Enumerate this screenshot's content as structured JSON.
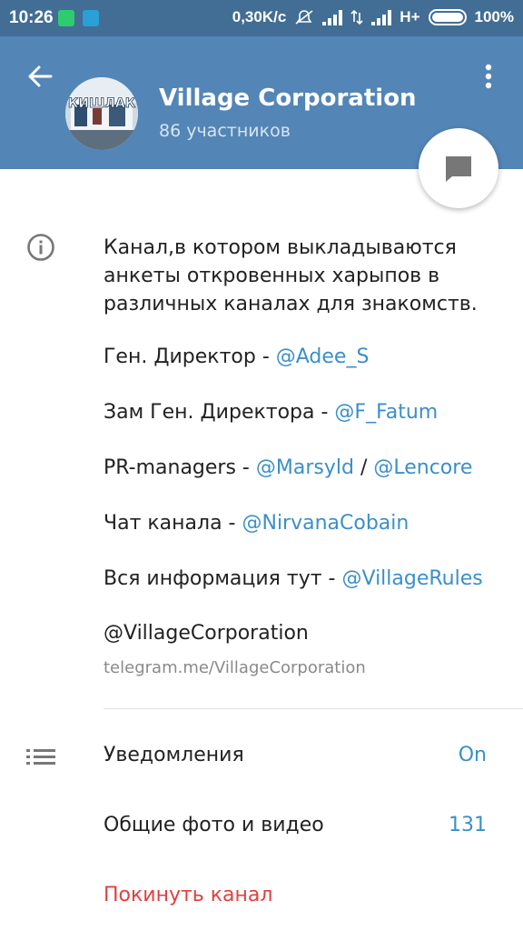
{
  "status_bar": {
    "time": "10:26",
    "speed": "0,30K/c",
    "network": "H+",
    "battery": "100%"
  },
  "header": {
    "title": "Village Corporation",
    "subtitle": "86 участников",
    "avatar_text": "КИШЛАК"
  },
  "description": {
    "text": "Канал,в котором выкладываются анкеты откровенных харыпов в различных каналах для знакомств.",
    "lines": [
      {
        "label": "Ген. Директор - ",
        "links": [
          "@Adee_S"
        ]
      },
      {
        "label": "Зам Ген. Директора - ",
        "links": [
          "@F_Fatum"
        ]
      },
      {
        "label": "PR-managers - ",
        "links": [
          "@Marsyld",
          "@Lencore"
        ],
        "separator": " / "
      },
      {
        "label": "Чат канала - ",
        "links": [
          "@NirvanaCobain"
        ]
      },
      {
        "label": "Вся информация тут - ",
        "links": [
          "@VillageRules"
        ]
      }
    ]
  },
  "username": "@VillageCorporation",
  "link": "telegram.me/VillageCorporation",
  "settings": {
    "notifications_label": "Уведомления",
    "notifications_value": "On",
    "media_label": "Общие фото и видео",
    "media_value": "131",
    "leave_label": "Покинуть канал"
  },
  "colors": {
    "app_bar": "#5385b6",
    "status_bar": "#426d94",
    "link": "#3b8fc9",
    "danger": "#e0403d"
  }
}
